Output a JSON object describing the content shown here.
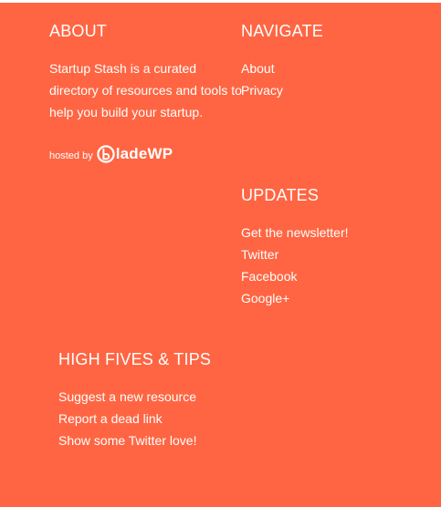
{
  "colors": {
    "footer_background": "#ff6542",
    "text": "#ffffff"
  },
  "about": {
    "heading": "ABOUT",
    "text": "Startup Stash is a curated directory of resources and tools to help you build your startup.",
    "hosted_by_label": "hosted by",
    "hosting_logo": {
      "wordmark": "ladeWP",
      "icon": "bladewp-b-icon"
    }
  },
  "navigate": {
    "heading": "NAVIGATE",
    "links": [
      "About",
      "Privacy"
    ]
  },
  "updates": {
    "heading": "UPDATES",
    "links": [
      "Get the newsletter!",
      "Twitter",
      "Facebook",
      "Google+"
    ]
  },
  "tips": {
    "heading": "HIGH FIVES & TIPS",
    "links": [
      "Suggest a new resource",
      "Report a dead link",
      "Show some Twitter love!"
    ]
  }
}
